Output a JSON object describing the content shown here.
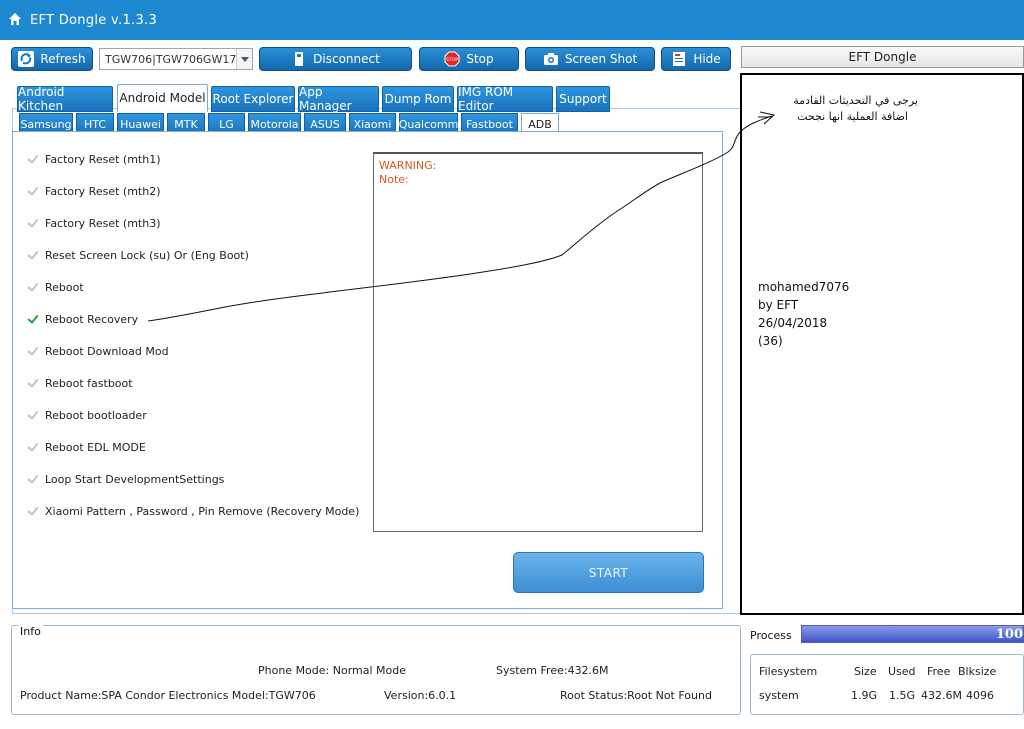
{
  "app": {
    "title": "EFT Dongle  v.1.3.3"
  },
  "toolbar": {
    "refresh_label": "Refresh",
    "device_value": "TGW706|TGW706GW17",
    "disconnect_label": "Disconnect",
    "stop_label": "Stop",
    "stop_icon_text": "STOP",
    "screenshot_label": "Screen Shot",
    "hide_label": "Hide"
  },
  "tabs": [
    "Android Kitchen",
    "Android Model",
    "Root Explorer",
    "App Manager",
    "Dump Rom",
    "IMG ROM Editor",
    "Support"
  ],
  "active_tab": "Android Model",
  "subtabs": [
    "Samsung",
    "HTC",
    "Huawei",
    "MTK",
    "LG",
    "Motorola",
    "ASUS",
    "Xiaomi",
    "Qualcomm",
    "Fastboot",
    "ADB"
  ],
  "active_subtab": "ADB",
  "options": [
    {
      "label": "Factory Reset (mth1)",
      "checked": false
    },
    {
      "label": "Factory Reset (mth2)",
      "checked": false
    },
    {
      "label": "Factory Reset (mth3)",
      "checked": false
    },
    {
      "label": "Reset Screen Lock (su) Or  (Eng Boot)",
      "checked": false
    },
    {
      "label": "Reboot",
      "checked": false
    },
    {
      "label": "Reboot Recovery",
      "checked": true
    },
    {
      "label": "Reboot Download Mod",
      "checked": false
    },
    {
      "label": "Reboot fastboot",
      "checked": false
    },
    {
      "label": "Reboot bootloader",
      "checked": false
    },
    {
      "label": "Reboot EDL MODE",
      "checked": false
    },
    {
      "label": "Loop Start  DevelopmentSettings",
      "checked": false
    },
    {
      "label": "Xiaomi Pattern , Password , Pin Remove (Recovery Mode)",
      "checked": false
    }
  ],
  "log": {
    "line1": "WARNING:",
    "line2": "Note:"
  },
  "start_label": "START",
  "right_panel": {
    "title": "EFT Dongle",
    "arabic_line1": "يرجى في التحديثات القادمة",
    "arabic_line2": "اضافة العملية انها نجحت",
    "sig_line1": "mohamed7076",
    "sig_line2": "by EFT",
    "sig_line3": "26/04/2018",
    "sig_line4": "(36)"
  },
  "info": {
    "label": "Info",
    "phone_mode": "Phone Mode: Normal Mode",
    "system_free": "System Free:432.6M",
    "product": "Product Name:SPA Condor Electronics  Model:TGW706",
    "version": "Version:6.0.1",
    "root_status": "Root Status:Root Not Found"
  },
  "process": {
    "label": "Process",
    "percent": 100,
    "percent_text": "100"
  },
  "filesystem": {
    "headers": [
      "Filesystem",
      "Size",
      "Used",
      "Free",
      "Blksize"
    ],
    "row": [
      "system",
      "1.9G",
      "1.5G",
      "432.6M",
      "4096"
    ]
  }
}
